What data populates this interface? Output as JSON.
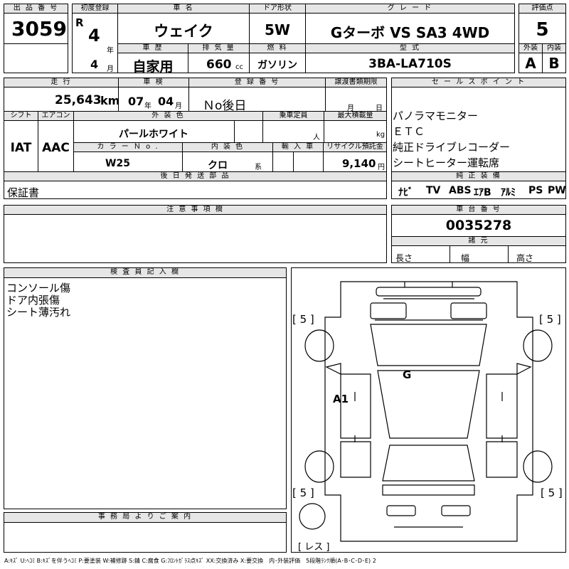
{
  "header": {
    "lot_label": "出 品 番 号",
    "lot_no": "3059",
    "first_reg_label": "初度登録",
    "era": "R",
    "reg_year": "4",
    "year_unit": "年",
    "reg_month": "4",
    "month_unit": "月",
    "car_name_label": "車 名",
    "car_name": "ウェイク",
    "door_label": "ドア形状",
    "door": "5W",
    "grade_label": "グ レ ー ド",
    "grade": "Gターボ VS SA3 4WD",
    "score_label": "評価点",
    "score": "5",
    "history_label": "車 歴",
    "history": "自家用",
    "displacement_label": "排 気 量",
    "displacement": "660",
    "displacement_unit": "cc",
    "fuel_label": "燃 料",
    "fuel": "ガソリン",
    "model_label": "型 式",
    "model": "3BA-LA710S",
    "exterior_label": "外装",
    "exterior": "A",
    "interior_label": "内装",
    "interior": "B"
  },
  "row2": {
    "mileage_label": "走 行",
    "mileage": "25,643",
    "mileage_unit": "km",
    "inspection_label": "車 検",
    "insp_year": "07",
    "insp_year_unit": "年",
    "insp_month": "04",
    "insp_month_unit": "月",
    "regno_label": "登 録 番 号",
    "regno": "Ｎo後日",
    "transfer_label": "譲渡書類期限",
    "transfer_month_unit": "月",
    "transfer_day_unit": "日",
    "shift_label": "シフト",
    "shift": "IAT",
    "ac_label": "エアコン",
    "ac": "AAC",
    "color_label": "外 装 色",
    "color": "パールホワイト",
    "capacity_label": "乗車定員",
    "capacity_unit": "人",
    "load_label": "最大積載量",
    "load_unit": "kg",
    "color_no_label": "カ ラ ー Ｎ o .",
    "color_no": "W25",
    "int_color_label": "内 装 色",
    "int_color": "クロ",
    "int_color_unit": "系",
    "import_label": "輸 入 車",
    "recycle_label": "リサイクル預託金",
    "recycle": "9,140",
    "recycle_unit": "円",
    "later_label": "後 日 発 送 部 品",
    "later": "保証書"
  },
  "sales": {
    "label": "セ ー ル ス ポ イ ン ト",
    "points": [
      "パノラマモニター",
      "ＥＴＣ",
      "純正ドライブレコーダー",
      "シートヒーター運転席"
    ],
    "equip_label": "純 正 装 備",
    "equipment": [
      "ﾅﾋﾞ",
      "TV",
      "ABS",
      "ｴｱB",
      "ｱﾙﾐ",
      "PS",
      "PW"
    ]
  },
  "notes": {
    "label": "注 意 事 項 欄"
  },
  "chassis": {
    "label": "車 台 番 号",
    "number": "0035278",
    "specs_label": "諸 元",
    "length_label": "長さ",
    "width_label": "幅",
    "height_label": "高さ"
  },
  "inspector": {
    "label": "検 査 員 記 入 欄",
    "lines": [
      "コンソール傷",
      "ドア内張傷",
      "シート薄汚れ"
    ]
  },
  "office": {
    "label": "事 務 局 よ り ご 案 内"
  },
  "diagram": {
    "tire_fl": "[ 5 ]",
    "tire_fr": "[ 5 ]",
    "tire_rl": "[ 5 ]",
    "tire_rr": "[ 5 ]",
    "spare": "[ レス ]",
    "mark_a1": "A1",
    "mark_g": "G"
  },
  "legend": "A:ｷｽﾞ U:ﾍｺﾐ B:ｷｽﾞを伴うﾍｺﾐ P:要塗装 W:補修跡 S:錆 C:腐食 G:ﾌﾛﾝﾄｶﾞﾗｽ点ｷｽﾞ XX:交換済み X:要交換　内･外装評価　5段階ﾗﾝｸ順(A･B･C･D･E) 2"
}
